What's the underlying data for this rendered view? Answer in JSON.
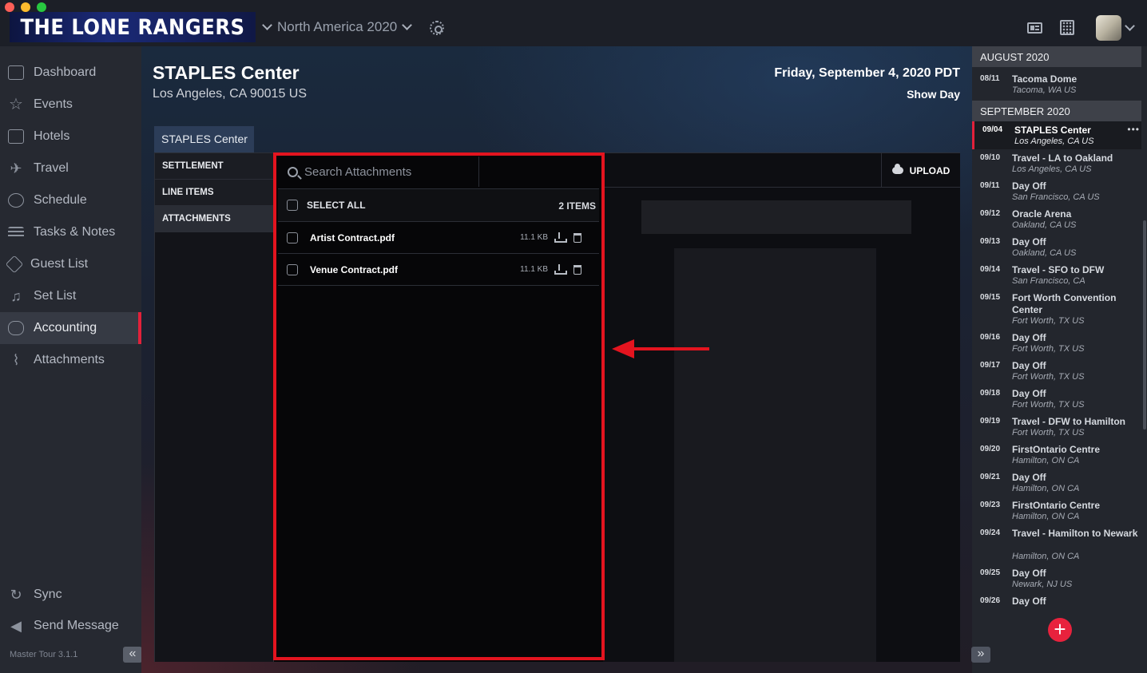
{
  "app": {
    "brand": "THE LONE RANGERS",
    "tour": "North America 2020",
    "version": "Master Tour 3.1.1"
  },
  "sidebar": {
    "items": [
      {
        "label": "Dashboard",
        "icon": "home-icon"
      },
      {
        "label": "Events",
        "icon": "star-icon"
      },
      {
        "label": "Hotels",
        "icon": "hotel-icon"
      },
      {
        "label": "Travel",
        "icon": "plane-icon"
      },
      {
        "label": "Schedule",
        "icon": "clock-icon"
      },
      {
        "label": "Tasks & Notes",
        "icon": "list-icon"
      },
      {
        "label": "Guest List",
        "icon": "ticket-icon"
      },
      {
        "label": "Set List",
        "icon": "music-note-icon"
      },
      {
        "label": "Accounting",
        "icon": "handshake-icon",
        "active": true
      },
      {
        "label": "Attachments",
        "icon": "paperclip-icon"
      }
    ],
    "footer": [
      {
        "label": "Sync",
        "icon": "sync-icon"
      },
      {
        "label": "Send Message",
        "icon": "megaphone-icon"
      }
    ],
    "collapse_glyph": "«"
  },
  "event": {
    "venue": "STAPLES Center",
    "address": "Los Angeles, CA 90015 US",
    "date": "Friday, September 4, 2020 PDT",
    "type": "Show Day",
    "tab": "STAPLES Center"
  },
  "subnav": [
    "SETTLEMENT",
    "LINE ITEMS",
    "ATTACHMENTS"
  ],
  "attachments": {
    "search_placeholder": "Search Attachments",
    "select_all": "SELECT ALL",
    "count": "2 ITEMS",
    "upload": "UPLOAD",
    "files": [
      {
        "name": "Artist Contract.pdf",
        "size": "11.1 KB"
      },
      {
        "name": "Venue Contract.pdf",
        "size": "11.1 KB"
      }
    ]
  },
  "rail": {
    "months": [
      "AUGUST 2020",
      "SEPTEMBER 2020"
    ],
    "august": [
      {
        "date": "08/11",
        "title": "Tacoma Dome",
        "loc": "Tacoma, WA US"
      }
    ],
    "september": [
      {
        "date": "09/04",
        "title": "STAPLES Center",
        "loc": "Los Angeles, CA US",
        "selected": true,
        "more": "•••"
      },
      {
        "date": "09/10",
        "title": "Travel - LA to Oakland",
        "loc": "Los Angeles, CA US"
      },
      {
        "date": "09/11",
        "title": "Day Off",
        "loc": "San Francisco, CA US"
      },
      {
        "date": "09/12",
        "title": "Oracle Arena",
        "loc": "Oakland, CA US"
      },
      {
        "date": "09/13",
        "title": "Day Off",
        "loc": "Oakland, CA US"
      },
      {
        "date": "09/14",
        "title": "Travel - SFO to DFW",
        "loc": "San Francisco, CA"
      },
      {
        "date": "09/15",
        "title": "Fort Worth Convention Center",
        "loc": "Fort Worth, TX US"
      },
      {
        "date": "09/16",
        "title": "Day Off",
        "loc": "Fort Worth, TX US"
      },
      {
        "date": "09/17",
        "title": "Day Off",
        "loc": "Fort Worth, TX US"
      },
      {
        "date": "09/18",
        "title": "Day Off",
        "loc": "Fort Worth, TX US"
      },
      {
        "date": "09/19",
        "title": "Travel - DFW to Hamilton",
        "loc": "Fort Worth, TX US"
      },
      {
        "date": "09/20",
        "title": "FirstOntario Centre",
        "loc": "Hamilton, ON CA"
      },
      {
        "date": "09/21",
        "title": "Day Off",
        "loc": "Hamilton, ON CA"
      },
      {
        "date": "09/23",
        "title": "FirstOntario Centre",
        "loc": "Hamilton, ON CA"
      },
      {
        "date": "09/24",
        "title": "Travel - Hamilton to Newark",
        "loc": "Hamilton, ON CA"
      },
      {
        "date": "09/25",
        "title": "Day Off",
        "loc": "Newark, NJ US"
      },
      {
        "date": "09/26",
        "title": "Day Off",
        "loc": ""
      }
    ],
    "add_glyph": "+",
    "expand_glyph": "»"
  },
  "colors": {
    "accent": "#e2213a",
    "highlight": "#e3141f",
    "sidebar_bg": "#262931",
    "rail_bg": "#23262d"
  }
}
